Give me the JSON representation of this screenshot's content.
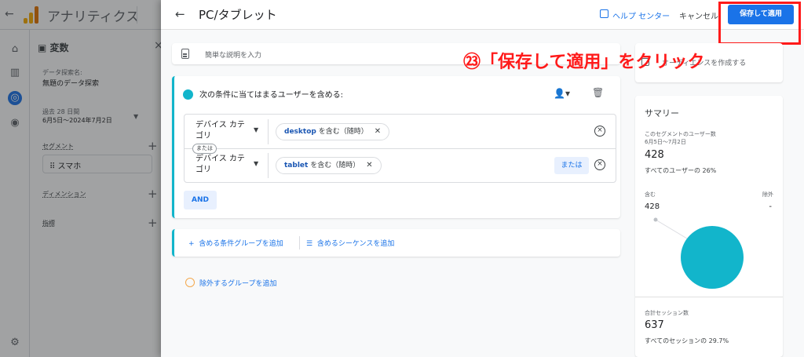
{
  "app": {
    "title": "アナリティクス"
  },
  "variables_panel": {
    "header": "変数",
    "exploration_name_label": "データ探索名:",
    "exploration_name": "無題のデータ探索",
    "date_label": "過去 28 日間",
    "date_range": "6月5日～2024年7月2日",
    "segments_label": "セグメント",
    "segment_item": "スマホ",
    "dimensions_label": "ディメンション",
    "metrics_label": "指標"
  },
  "dialog": {
    "title": "PC/タブレット",
    "help_link": "ヘルプ センター",
    "cancel_label": "キャンセル",
    "save_label": "保存して適用",
    "description_placeholder": "簡単な説明を入力",
    "annotation": "㉓「保存して適用」をクリック",
    "condition_header": "次の条件に当てはまるユーザーを含める:",
    "rows": [
      {
        "dimension": "デバイス カテゴリ",
        "value": "desktop",
        "operator": "を含む（随時）"
      },
      {
        "dimension": "デバイス カテゴリ",
        "value": "tablet",
        "operator": "を含む（随時）"
      }
    ],
    "or_tag": "または",
    "or_button": "または",
    "and_button": "AND",
    "add_include_group": "含める条件グループを追加",
    "add_include_sequence": "含めるシーケンスを追加",
    "add_exclude_group": "除外するグループを追加"
  },
  "side": {
    "audience_text": "オーディエンスを作成する"
  },
  "summary": {
    "title": "サマリー",
    "users_label": "このセグメントのユーザー数",
    "users_date": "6月5日～7月2日",
    "users_value": "428",
    "users_pct": "すべてのユーザーの 26%",
    "include_label": "含む",
    "include_value": "428",
    "exclude_label": "除外",
    "exclude_value": "-",
    "sessions_label": "合計セッション数",
    "sessions_value": "637",
    "sessions_pct": "すべてのセッションの 29.7%"
  },
  "colors": {
    "primary": "#1a73e8",
    "teal": "#12b5cb",
    "annotation_red": "#ff1a1a"
  }
}
